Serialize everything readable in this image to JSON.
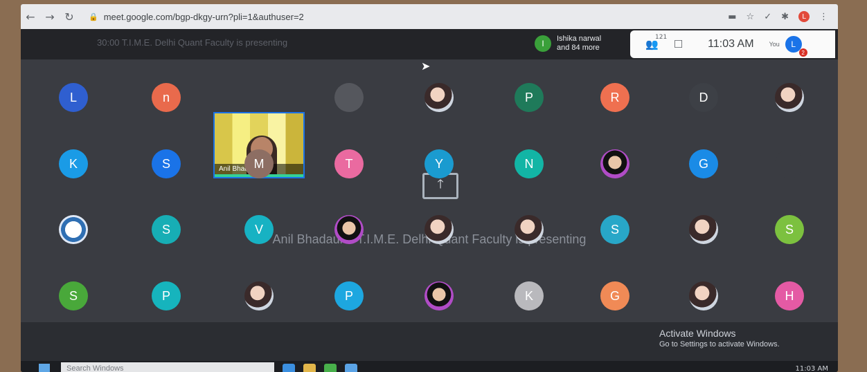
{
  "browser": {
    "url": "meet.google.com/bgp-dkgy-urn?pli=1&authuser=2",
    "profile_initial": "L"
  },
  "meet": {
    "presenting_top": "30:00 T.I.M.E. Delhi Quant Faculty is presenting",
    "speaker_initial": "I",
    "speaker_line1": "Ishika narwal",
    "speaker_line2": "and 84 more",
    "participant_count": "121",
    "time": "11:03 AM",
    "you_label": "You",
    "you_initial": "L",
    "notification_count": "2",
    "video_name": "Anil Bhadauria ...",
    "presenting_center": "Anil Bhadauria T.I.M.E. Delhi Quant Faculty is presenting",
    "rows": [
      [
        {
          "i": "L",
          "c": "#2f5fd0"
        },
        {
          "i": "n",
          "c": "#e96a4c"
        },
        {
          "i": "",
          "c": "video"
        },
        {
          "i": "",
          "c": "#55575d"
        },
        {
          "i": "",
          "c": "photo"
        },
        {
          "i": "P",
          "c": "#1f7a5a"
        },
        {
          "i": "R",
          "c": "#ef7050"
        },
        {
          "i": "D",
          "c": "#3d4046"
        },
        {
          "i": "",
          "c": "photo"
        }
      ],
      [
        {
          "i": "K",
          "c": "#1a9be6"
        },
        {
          "i": "S",
          "c": "#1a73e8"
        },
        {
          "i": "M",
          "c": "#8d6e63"
        },
        {
          "i": "T",
          "c": "#ea6aa0"
        },
        {
          "i": "Y",
          "c": "#1a9bd0"
        },
        {
          "i": "N",
          "c": "#12b5a5"
        },
        {
          "i": "",
          "c": "photo2"
        },
        {
          "i": "G",
          "c": "#1a8be6"
        },
        {
          "i": "",
          "c": "#3a3c42"
        }
      ],
      [
        {
          "i": "",
          "c": "logo"
        },
        {
          "i": "S",
          "c": "#17aeb5"
        },
        {
          "i": "V",
          "c": "#17b2c3"
        },
        {
          "i": "",
          "c": "photo2"
        },
        {
          "i": "",
          "c": "photo"
        },
        {
          "i": "",
          "c": "photo"
        },
        {
          "i": "S",
          "c": "#28a7c8"
        },
        {
          "i": "",
          "c": "photo"
        },
        {
          "i": "S",
          "c": "#7cc13f"
        }
      ],
      [
        {
          "i": "S",
          "c": "#49a83a"
        },
        {
          "i": "P",
          "c": "#16b4bd"
        },
        {
          "i": "",
          "c": "photo"
        },
        {
          "i": "P",
          "c": "#1da7e0"
        },
        {
          "i": "",
          "c": "photo2"
        },
        {
          "i": "K",
          "c": "#b9b9bd"
        },
        {
          "i": "G",
          "c": "#f08a56"
        },
        {
          "i": "",
          "c": "photo"
        },
        {
          "i": "H",
          "c": "#e45aa4"
        }
      ]
    ]
  },
  "windows": {
    "activate_title": "Activate Windows",
    "activate_sub": "Go to Settings to activate Windows.",
    "search_placeholder": "Search Windows",
    "tray_time": "11:03 AM"
  },
  "colors": {
    "accent": "#1a73e8"
  }
}
